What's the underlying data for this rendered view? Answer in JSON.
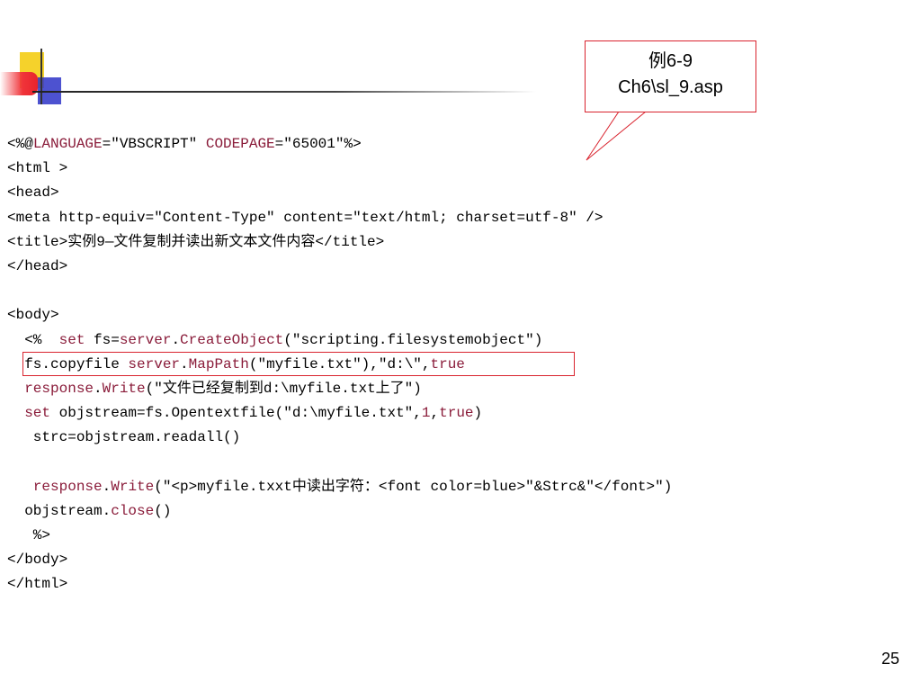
{
  "callout": {
    "line1": "例6-9",
    "line2": "Ch6\\sl_9.asp"
  },
  "code_lines": [
    [
      {
        "t": "<%@"
      },
      {
        "t": "LANGUAGE",
        "c": "kw"
      },
      {
        "t": "=\"VBSCRIPT\" "
      },
      {
        "t": "CODEPAGE",
        "c": "kw"
      },
      {
        "t": "=\"65001\"%>"
      }
    ],
    [
      {
        "t": "<html >"
      }
    ],
    [
      {
        "t": "<head>"
      }
    ],
    [
      {
        "t": "<meta http-equiv=\"Content-Type\" content=\"text/html; charset=utf-8\" />"
      }
    ],
    [
      {
        "t": "<title>实例9—文件复制并读出新文本文件内容</title>"
      }
    ],
    [
      {
        "t": "</head>"
      }
    ],
    [
      {
        "t": ""
      }
    ],
    [
      {
        "t": "<body>"
      }
    ],
    [
      {
        "t": "  <%  "
      },
      {
        "t": "set",
        "c": "kw"
      },
      {
        "t": " fs="
      },
      {
        "t": "server",
        "c": "kw"
      },
      {
        "t": "."
      },
      {
        "t": "CreateObject",
        "c": "kw"
      },
      {
        "t": "(\"scripting.filesystemobject\")"
      }
    ],
    [
      {
        "t": "  fs.copyfile "
      },
      {
        "t": "server",
        "c": "kw"
      },
      {
        "t": "."
      },
      {
        "t": "MapPath",
        "c": "kw"
      },
      {
        "t": "(\"myfile.txt\"),\"d:\\\","
      },
      {
        "t": "true",
        "c": "kw"
      }
    ],
    [
      {
        "t": "  "
      },
      {
        "t": "response",
        "c": "kw"
      },
      {
        "t": "."
      },
      {
        "t": "Write",
        "c": "kw"
      },
      {
        "t": "(\"文件已经复制到d:\\myfile.txt上了\")"
      }
    ],
    [
      {
        "t": "  "
      },
      {
        "t": "set",
        "c": "kw"
      },
      {
        "t": " objstream=fs.Opentextfile(\"d:\\myfile.txt\","
      },
      {
        "t": "1",
        "c": "kw"
      },
      {
        "t": ","
      },
      {
        "t": "true",
        "c": "kw"
      },
      {
        "t": ")"
      }
    ],
    [
      {
        "t": "   strc=objstream.readall()"
      }
    ],
    [
      {
        "t": ""
      }
    ],
    [
      {
        "t": "   "
      },
      {
        "t": "response",
        "c": "kw"
      },
      {
        "t": "."
      },
      {
        "t": "Write",
        "c": "kw"
      },
      {
        "t": "(\"<p>myfile.txxt中读出字符：<font color=blue>\"&Strc&\"</font>\")"
      }
    ],
    [
      {
        "t": "  objstream."
      },
      {
        "t": "close",
        "c": "kw"
      },
      {
        "t": "()"
      }
    ],
    [
      {
        "t": "   %>"
      }
    ],
    [
      {
        "t": "</body>"
      }
    ],
    [
      {
        "t": "</html>"
      }
    ]
  ],
  "page_number": "25",
  "colors": {
    "keyword": "#8a1c3a",
    "accent_red": "#d9232e",
    "logo_yellow": "#f5d22b",
    "logo_blue": "#2e34c8"
  }
}
